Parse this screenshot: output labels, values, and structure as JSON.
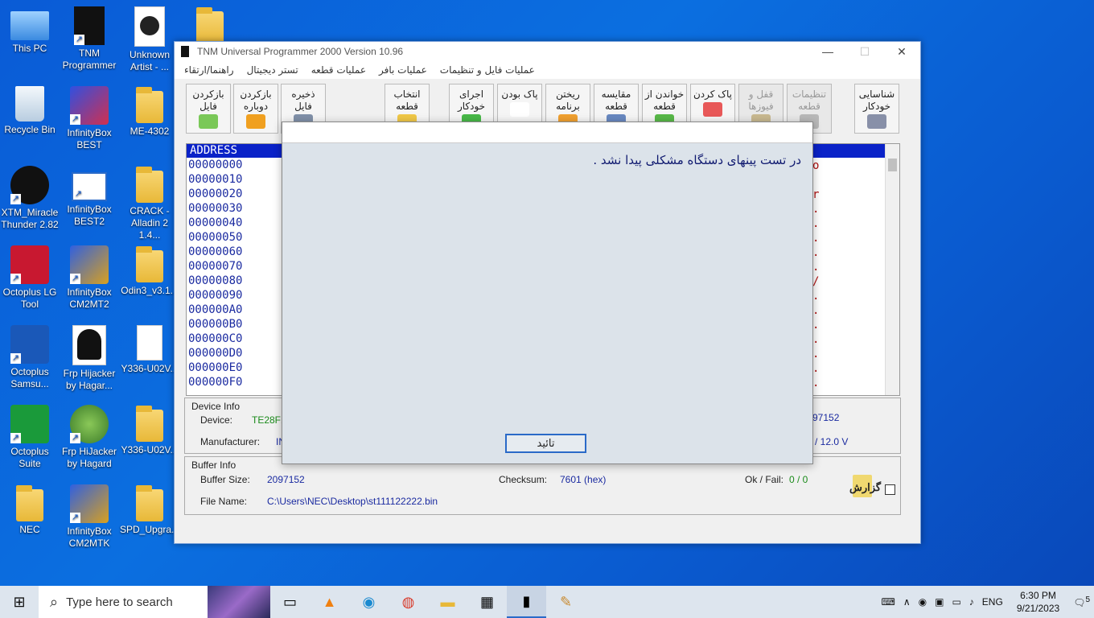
{
  "desktop": {
    "icons": [
      {
        "label": "This PC",
        "type": "pc"
      },
      {
        "label": "TNM Programmer",
        "type": "dark"
      },
      {
        "label": "Unknown Artist - ...",
        "type": "paper"
      },
      {
        "label": "",
        "type": "folder"
      },
      {
        "label": "Recycle Bin",
        "type": "bin"
      },
      {
        "label": "InfinityBox BEST",
        "type": "shield"
      },
      {
        "label": "ME-4302",
        "type": "folder"
      },
      {
        "label": "XTM_Miracle Thunder 2.82",
        "type": "dark"
      },
      {
        "label": "InfinityBox BEST2",
        "type": "shield"
      },
      {
        "label": "CRACK - Alladin 2 1.4...",
        "type": "folder"
      },
      {
        "label": "Octoplus LG Tool",
        "type": "octo"
      },
      {
        "label": "InfinityBox CM2MT2",
        "type": "shield"
      },
      {
        "label": "Odin3_v3.1...",
        "type": "folder"
      },
      {
        "label": "Octoplus Samsu...",
        "type": "octo"
      },
      {
        "label": "Frp Hijacker by Hagar...",
        "type": "paper"
      },
      {
        "label": "Y336-U02V...",
        "type": "paper"
      },
      {
        "label": "Octoplus Suite",
        "type": "octo"
      },
      {
        "label": "Frp HiJacker by Hagard",
        "type": "frp"
      },
      {
        "label": "Y336-U02V...",
        "type": "folder"
      },
      {
        "label": "NEC",
        "type": "user"
      },
      {
        "label": "InfinityBox CM2MTK",
        "type": "shield"
      },
      {
        "label": "SPD_Upgra...",
        "type": "folder"
      }
    ]
  },
  "window": {
    "title": "TNM  Universal Programmer 2000   Version 10.96",
    "controls": {
      "min": "—",
      "max": "☐",
      "close": "✕"
    },
    "menu": [
      "راهنما/ارتقاء",
      "تستر دیجیتال",
      "عملیات قطعه",
      "عملیات بافر",
      "عملیات فایل و تنظیمات"
    ],
    "toolbar": [
      {
        "label": "بازکردن فایل",
        "disabled": false
      },
      {
        "label": "بازکردن دوباره",
        "disabled": false
      },
      {
        "label": "ذخیره فایل",
        "disabled": false
      },
      {
        "label": "انتخاب قطعه",
        "disabled": false
      },
      {
        "label": "اجرای خودکار",
        "disabled": false
      },
      {
        "label": "پاک بودن",
        "disabled": false
      },
      {
        "label": "ریختن برنامه",
        "disabled": false
      },
      {
        "label": "مقایسه قطعه",
        "disabled": false
      },
      {
        "label": "خواندن از قطعه",
        "disabled": false
      },
      {
        "label": "پاک کردن",
        "disabled": false
      },
      {
        "label": "قفل و فیوزها",
        "disabled": true
      },
      {
        "label": "تنظیمات قطعه",
        "disabled": true
      },
      {
        "label": "شناسایی خودکار",
        "disabled": false
      }
    ],
    "hex": {
      "header": "ADDRESS",
      "rows": [
        "00000000",
        "00000010",
        "00000020",
        "00000030",
        "00000040",
        "00000050",
        "00000060",
        "00000070",
        "00000080",
        "00000090",
        "000000A0",
        "000000B0",
        "000000C0",
        "000000D0",
        "000000E0",
        "000000F0"
      ],
      "right_chars": [
        "o",
        "",
        "r",
        ".",
        ".",
        ".",
        ".",
        ".",
        "/",
        ".",
        ".",
        ".",
        ".",
        ".",
        ".",
        "."
      ]
    },
    "device_info": {
      "title": "Device Info",
      "device_label": "Device:",
      "device_value": "TE28F1",
      "size_tail": "97152",
      "manufacturer_label": "Manufacturer:",
      "manufacturer_value": "IN",
      "voltage_tail": "/ 12.0 V"
    },
    "buffer_info": {
      "title": "Buffer Info",
      "size_label": "Buffer Size:",
      "size_value": "2097152",
      "checksum_label": "Checksum:",
      "checksum_value": "7601 (hex)",
      "okfail_label": "Ok / Fail:",
      "okfail_value": "0 / 0",
      "file_label": "File Name:",
      "file_value": "C:\\Users\\NEC\\Desktop\\st111122222.bin",
      "report_label": "گزارش"
    }
  },
  "modal": {
    "message": "در تست پینهای دستگاه مشکلی پیدا نشد .",
    "ok_label": "تائید"
  },
  "taskbar": {
    "search_placeholder": "Type here to search",
    "lang": "ENG",
    "time": "6:30 PM",
    "date": "9/21/2023",
    "notifications": "5"
  }
}
